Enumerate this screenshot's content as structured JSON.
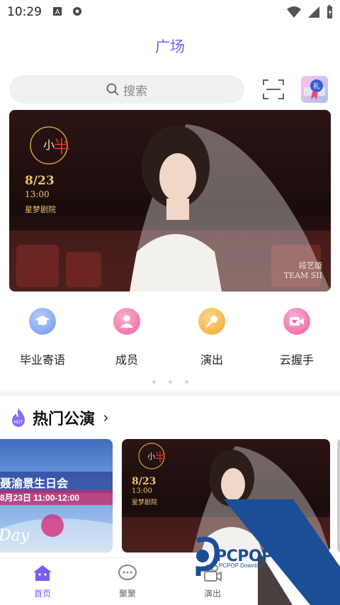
{
  "status": {
    "time": "10:29"
  },
  "header": {
    "title": "广场"
  },
  "search": {
    "placeholder": "搜索"
  },
  "banner": {
    "show_name": "小·半生",
    "date": "8/23",
    "time": "13:00",
    "venue": "星梦剧院",
    "brand_line1": "段艺璇",
    "brand_line2": "TEAM SII"
  },
  "quick_menu": [
    {
      "label": "毕业寄语",
      "icon": "graduation-cap-icon",
      "color": "#8fb1f5"
    },
    {
      "label": "成员",
      "icon": "member-icon",
      "color": "#f36fa9"
    },
    {
      "label": "演出",
      "icon": "microphone-icon",
      "color": "#f8b84a"
    },
    {
      "label": "云握手",
      "icon": "video-heart-icon",
      "color": "#f36fa9"
    }
  ],
  "hot": {
    "badge": "HOT",
    "title": "热门公演",
    "arrow": "›",
    "cards": [
      {
        "title": "聂渝景生日会",
        "time": "8月23日 11:00-12:00",
        "script": "Day"
      },
      {
        "show_name": "小·半生",
        "date": "8/23",
        "time": "13:00",
        "venue": "星梦剧院"
      }
    ]
  },
  "watermark": {
    "text": "PCPOP下载",
    "sub": "PCPOP Download"
  },
  "bottom_nav": [
    {
      "label": "首页",
      "active": true
    },
    {
      "label": "聚聚",
      "active": false
    },
    {
      "label": "演出",
      "active": false
    }
  ],
  "colors": {
    "accent": "#7b5cf0",
    "watermark": "#1a4f97"
  }
}
